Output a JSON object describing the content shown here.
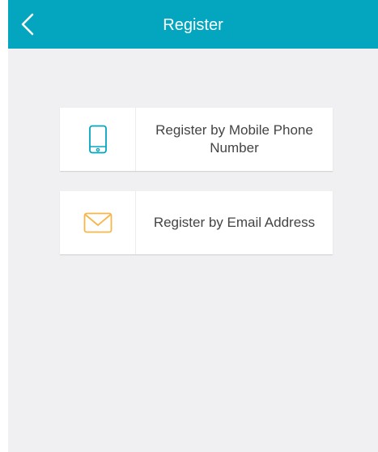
{
  "header": {
    "title": "Register",
    "color": "#03a6be"
  },
  "options": [
    {
      "label": "Register by Mobile Phone Number",
      "icon": "mobile-phone-icon",
      "icon_color": "#03a6be"
    },
    {
      "label": "Register by Email Address",
      "icon": "envelope-icon",
      "icon_color": "#f6b64a"
    }
  ],
  "colors": {
    "background": "#f0f0f2",
    "card": "#ffffff",
    "text": "#444444"
  }
}
